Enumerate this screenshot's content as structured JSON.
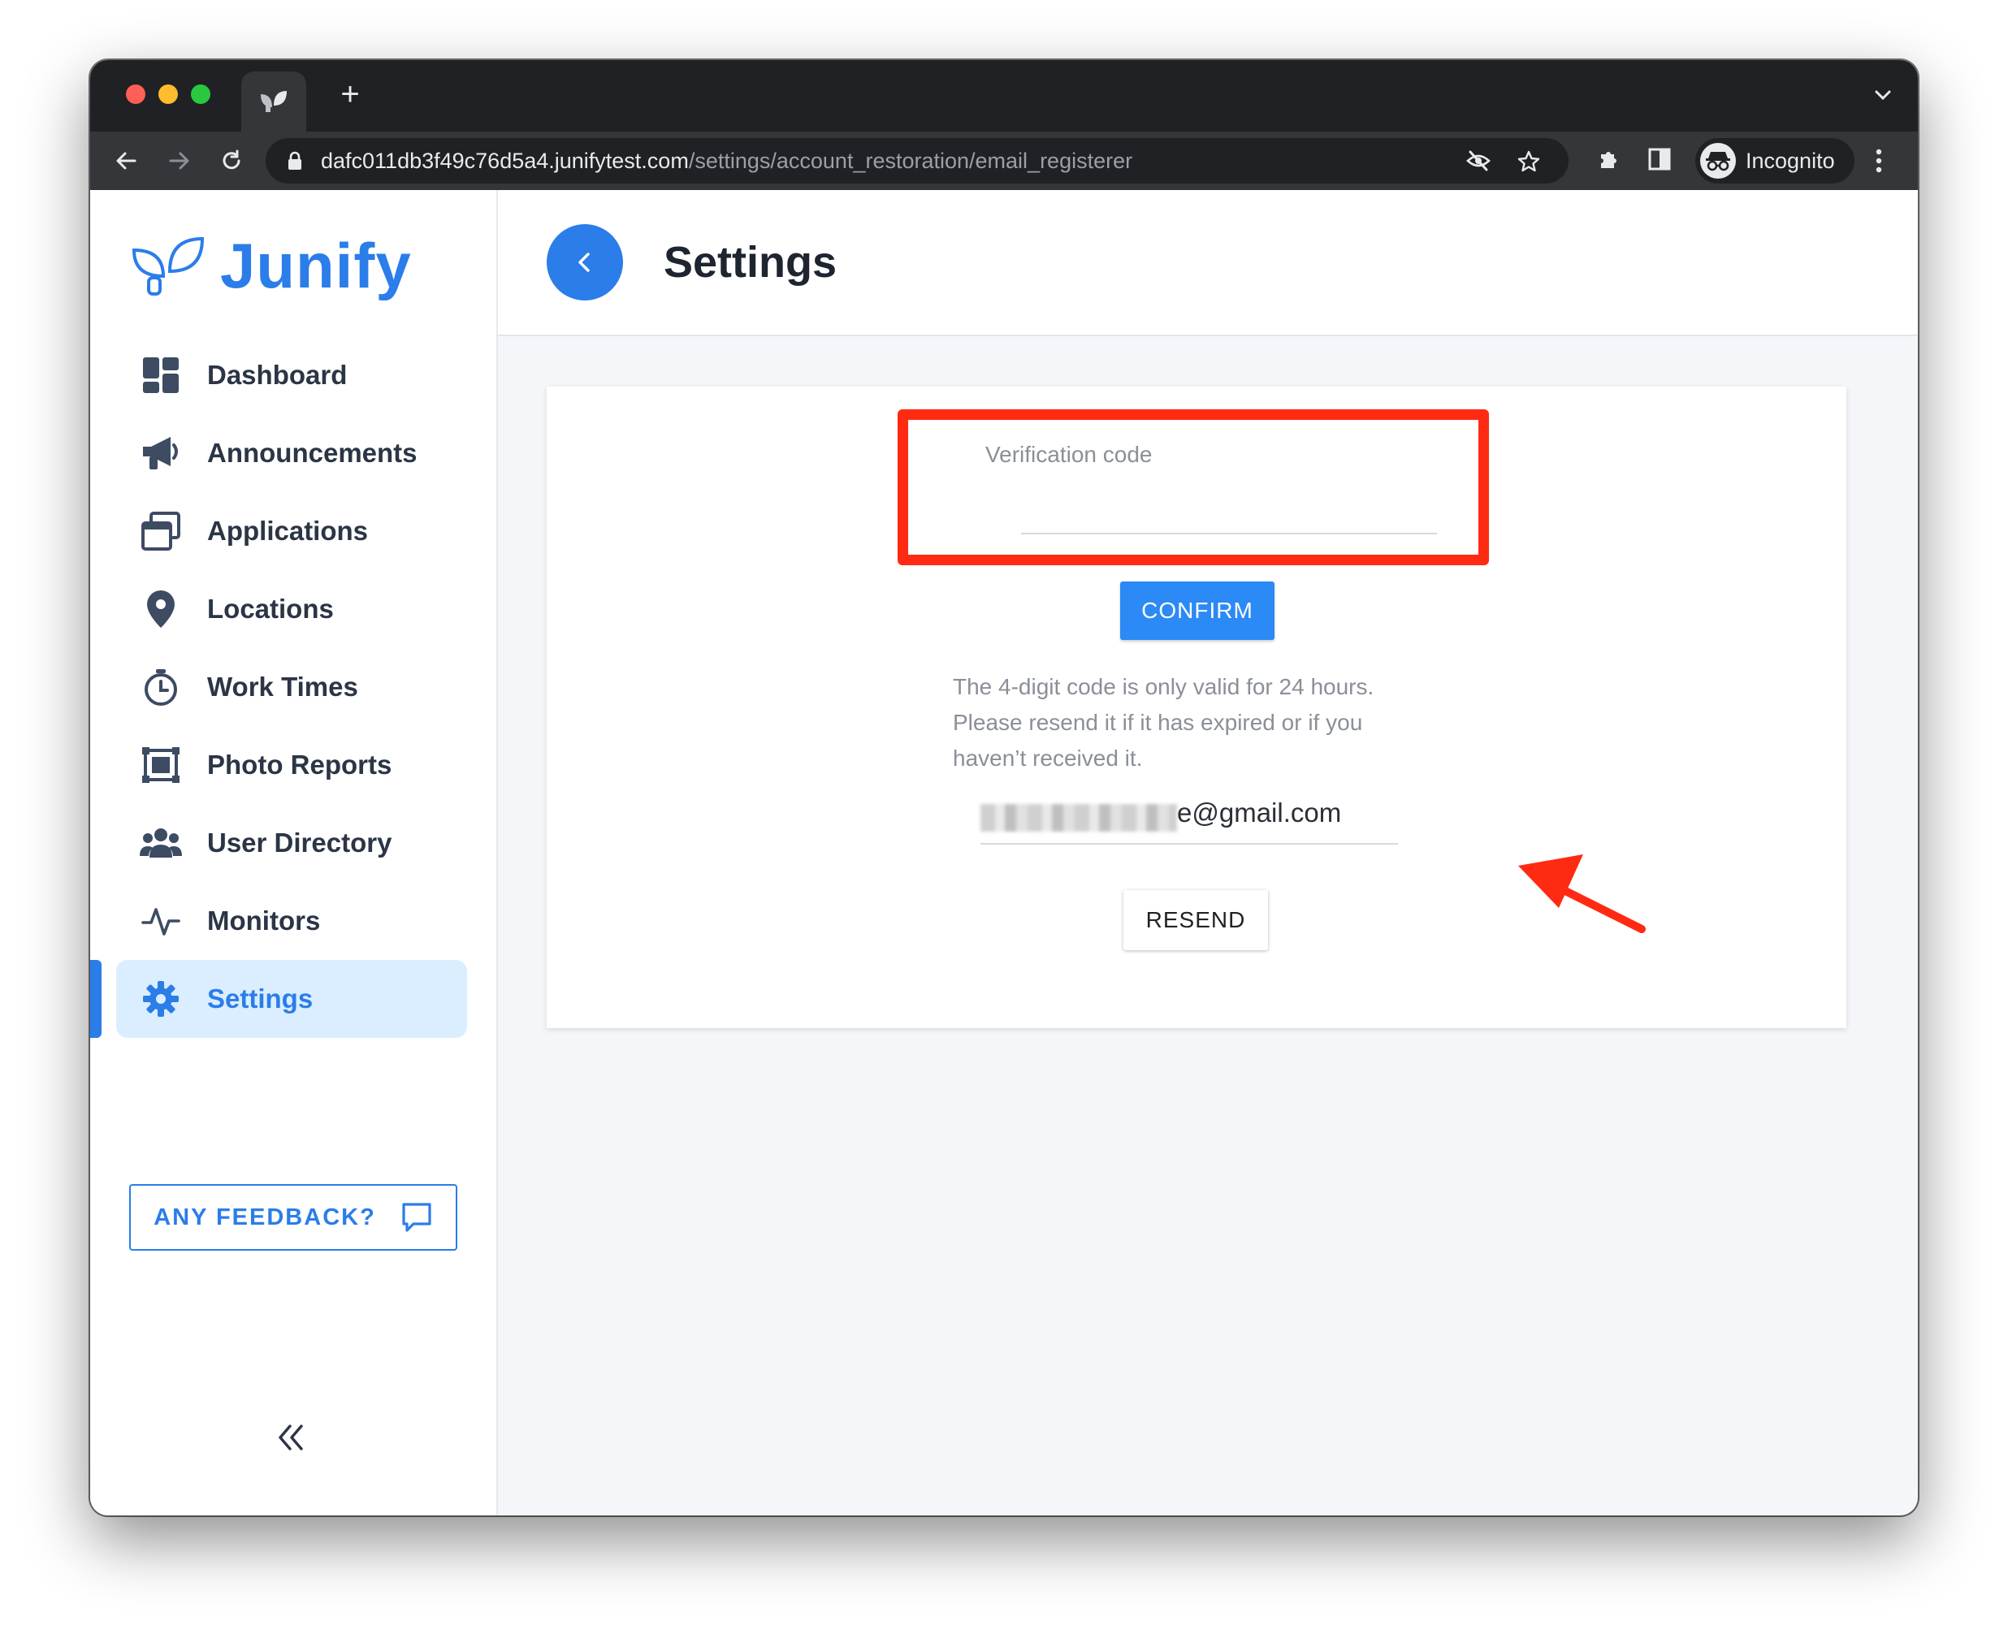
{
  "browser": {
    "url_host": "dafc011db3f49c76d5a4.junifytest.com",
    "url_path": "/settings/account_restoration/email_registerer",
    "profile_label": "Incognito",
    "new_tab_glyph": "+"
  },
  "sidebar": {
    "brand": "Junify",
    "items": [
      {
        "label": "Dashboard",
        "icon": "dashboard-icon"
      },
      {
        "label": "Announcements",
        "icon": "megaphone-icon"
      },
      {
        "label": "Applications",
        "icon": "windows-icon"
      },
      {
        "label": "Locations",
        "icon": "map-pin-icon"
      },
      {
        "label": "Work Times",
        "icon": "stopwatch-icon"
      },
      {
        "label": "Photo Reports",
        "icon": "photo-frame-icon"
      },
      {
        "label": "User Directory",
        "icon": "users-icon"
      },
      {
        "label": "Monitors",
        "icon": "pulse-icon"
      },
      {
        "label": "Settings",
        "icon": "gear-icon",
        "active": true
      }
    ],
    "feedback_label": "ANY FEEDBACK?",
    "collapse_glyph": "«"
  },
  "header": {
    "title": "Settings"
  },
  "form": {
    "code_label": "Verification code",
    "confirm_label": "CONFIRM",
    "hint": "The 4-digit code is only valid for 24 hours. Please resend it if it has expired or if you haven’t received it.",
    "email_visible": "e@gmail.com",
    "resend_label": "RESEND"
  },
  "colors": {
    "accent": "#2b7de9",
    "highlight": "#ff2a12"
  }
}
